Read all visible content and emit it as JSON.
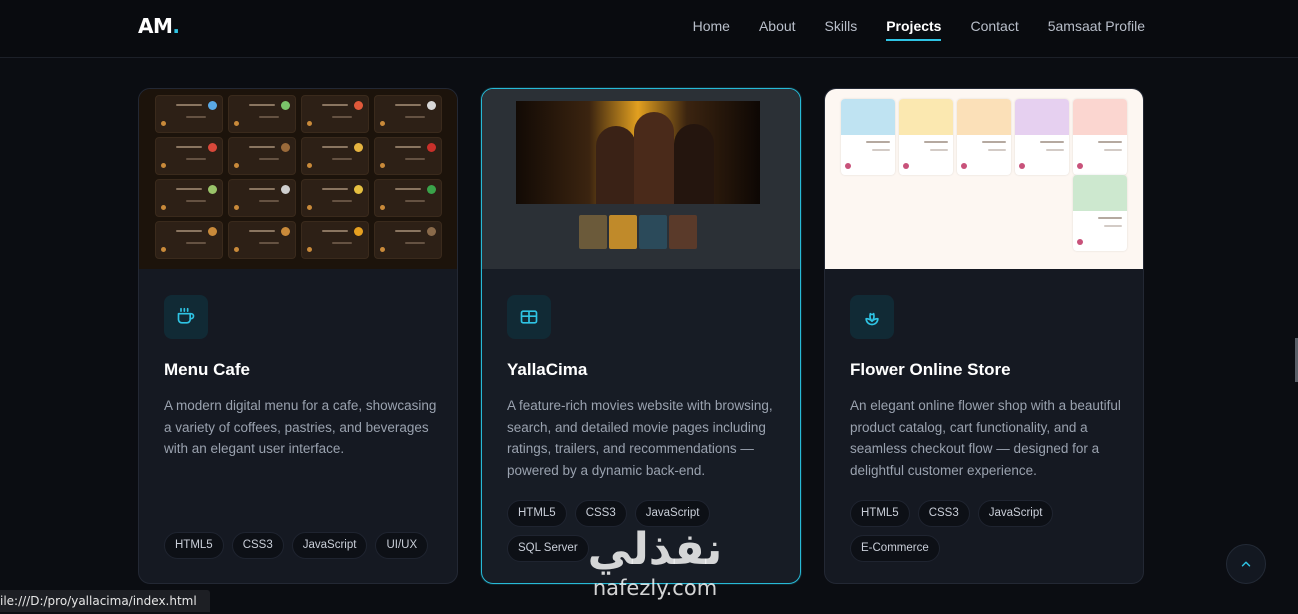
{
  "nav": {
    "logo_text": "AM",
    "logo_dot": ".",
    "links": [
      "Home",
      "About",
      "Skills",
      "Projects",
      "Contact",
      "5amsaat Profile"
    ],
    "active": "Projects"
  },
  "projects": [
    {
      "title": "Menu Cafe",
      "icon": "coffee-cup-icon",
      "description": "A modern digital menu for a cafe, showcasing a variety of coffees, pastries, and beverages with an elegant user interface.",
      "tags": [
        "HTML5",
        "CSS3",
        "JavaScript",
        "UI/UX"
      ]
    },
    {
      "title": "YallaCima",
      "icon": "film-icon",
      "description": "A feature-rich movies website with browsing, search, and detailed movie pages including ratings, trailers, and recommendations — powered by a dynamic back-end.",
      "tags": [
        "HTML5",
        "CSS3",
        "JavaScript",
        "SQL Server"
      ]
    },
    {
      "title": "Flower Online Store",
      "icon": "flower-icon",
      "description": "An elegant online flower shop with a beautiful product catalog, cart functionality, and a seamless checkout flow — designed for a delightful customer experience.",
      "tags": [
        "HTML5",
        "CSS3",
        "JavaScript",
        "E-Commerce"
      ]
    }
  ],
  "status_bar": "ile:///D:/pro/yallacima/index.html",
  "watermark": {
    "arabic": "نفذلي",
    "latin": "nafezly.com"
  },
  "colors": {
    "accent": "#2fc4e4",
    "card_bg": "#151922",
    "page_bg": "#0b0d12"
  }
}
